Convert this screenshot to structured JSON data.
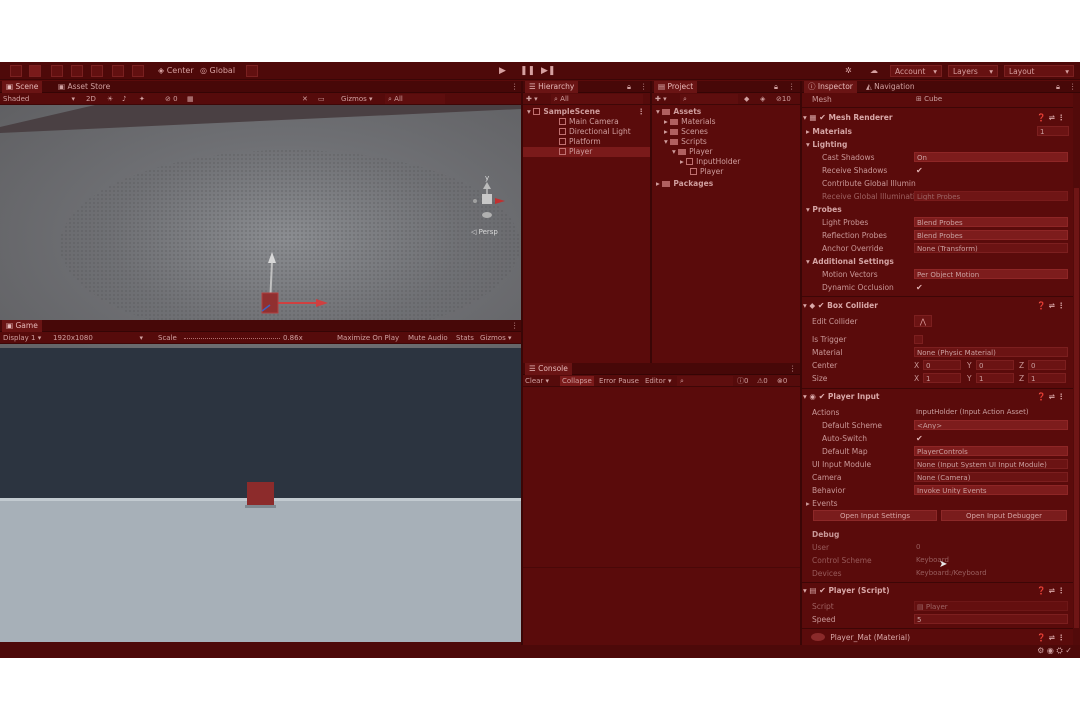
{
  "toolbar": {
    "center_label": "Center",
    "global_label": "Global",
    "account_label": "Account",
    "layers_label": "Layers",
    "layout_label": "Layout"
  },
  "scene": {
    "tabs": [
      "Scene",
      "Asset Store"
    ],
    "shading_mode": "Shaded",
    "mode_2d": "2D",
    "gizmos_label": "Gizmos",
    "search_placeholder": "All",
    "persp_label": "◁ Persp",
    "gizmo_axis_y": "y"
  },
  "game": {
    "tab": "Game",
    "display": "Display 1",
    "resolution": "1920x1080",
    "scale_label": "Scale",
    "scale_value": "0.86x",
    "maximize_label": "Maximize On Play",
    "mute_label": "Mute Audio",
    "stats_label": "Stats",
    "gizmos_label": "Gizmos"
  },
  "hierarchy": {
    "tab": "Hierarchy",
    "search_placeholder": "All",
    "scene_name": "SampleScene",
    "items": [
      "Main Camera",
      "Directional Light",
      "Platform",
      "Player"
    ]
  },
  "project": {
    "tab": "Project",
    "badge": "10",
    "tree": [
      {
        "label": "Assets",
        "level": 0,
        "bold": true
      },
      {
        "label": "Materials",
        "level": 1
      },
      {
        "label": "Scenes",
        "level": 1
      },
      {
        "label": "Scripts",
        "level": 1
      },
      {
        "label": "Player",
        "level": 2
      },
      {
        "label": "InputHolder",
        "level": 3
      },
      {
        "label": "Player",
        "level": 3
      },
      {
        "label": "Packages",
        "level": 0,
        "bold": true
      }
    ]
  },
  "console": {
    "tab": "Console",
    "clear": "Clear",
    "collapse": "Collapse",
    "error_pause": "Error Pause",
    "editor": "Editor",
    "count_log": "0",
    "count_warn": "0",
    "count_err": "0"
  },
  "inspector": {
    "tabs": [
      "Inspector",
      "Navigation"
    ],
    "mesh_label": "Mesh",
    "mesh_value": "Cube",
    "mesh_renderer": {
      "title": "Mesh Renderer",
      "materials_label": "Materials",
      "materials_count": "1",
      "lighting_label": "Lighting",
      "cast_shadows_label": "Cast Shadows",
      "cast_shadows_value": "On",
      "receive_shadows_label": "Receive Shadows",
      "contribute_gi_label": "Contribute Global Illumin",
      "receive_gi_label": "Receive Global Illuminati",
      "receive_gi_value": "Light Probes",
      "probes_label": "Probes",
      "light_probes_label": "Light Probes",
      "light_probes_value": "Blend Probes",
      "reflection_probes_label": "Reflection Probes",
      "reflection_probes_value": "Blend Probes",
      "anchor_override_label": "Anchor Override",
      "anchor_override_value": "None (Transform)",
      "additional_label": "Additional Settings",
      "motion_vectors_label": "Motion Vectors",
      "motion_vectors_value": "Per Object Motion",
      "dynamic_occlusion_label": "Dynamic Occlusion"
    },
    "box_collider": {
      "title": "Box Collider",
      "edit_collider_label": "Edit Collider",
      "is_trigger_label": "Is Trigger",
      "material_label": "Material",
      "material_value": "None (Physic Material)",
      "center_label": "Center",
      "center_x": "0",
      "center_y": "0",
      "center_z": "0",
      "size_label": "Size",
      "size_x": "1",
      "size_y": "1",
      "size_z": "1"
    },
    "player_input": {
      "title": "Player Input",
      "actions_label": "Actions",
      "actions_value": "InputHolder (Input Action Asset)",
      "default_scheme_label": "Default Scheme",
      "default_scheme_value": "<Any>",
      "auto_switch_label": "Auto-Switch",
      "default_map_label": "Default Map",
      "default_map_value": "PlayerControls",
      "ui_module_label": "UI Input Module",
      "ui_module_value": "None (Input System UI Input Module)",
      "camera_label": "Camera",
      "camera_value": "None (Camera)",
      "behavior_label": "Behavior",
      "behavior_value": "Invoke Unity Events",
      "events_label": "Events",
      "open_settings": "Open Input Settings",
      "open_debugger": "Open Input Debugger",
      "debug_label": "Debug",
      "user_label": "User",
      "user_value": "0",
      "control_scheme_label": "Control Scheme",
      "control_scheme_value": "Keyboard",
      "devices_label": "Devices",
      "devices_value": "Keyboard:/Keyboard"
    },
    "player_script": {
      "title": "Player (Script)",
      "script_label": "Script",
      "script_value": "Player",
      "speed_label": "Speed",
      "speed_value": "5"
    },
    "material": {
      "title": "Player_Mat (Material)"
    }
  },
  "colors": {
    "overlay": "#5a0b0b",
    "game_sky": "#2b3440",
    "ground": "#a8b2ba",
    "cube": "#8a2a2a"
  }
}
